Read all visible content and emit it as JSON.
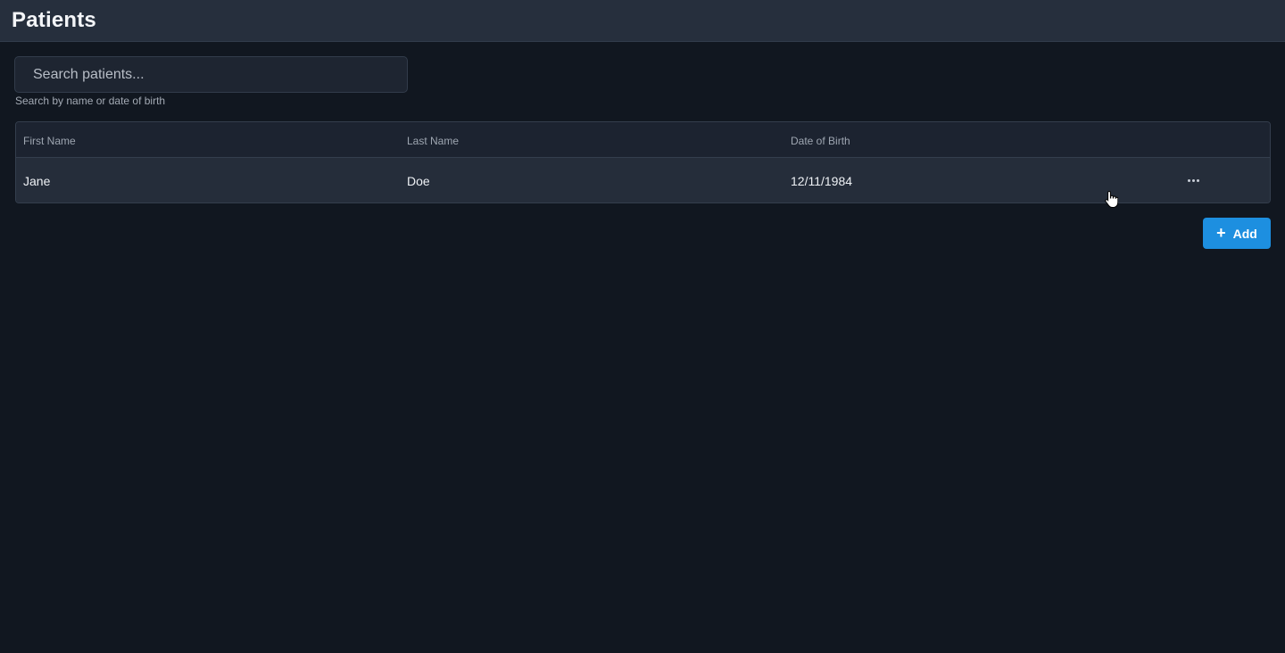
{
  "header": {
    "title": "Patients"
  },
  "search": {
    "placeholder": "Search patients...",
    "value": "",
    "hint": "Search by name or date of birth"
  },
  "table": {
    "columns": [
      "First Name",
      "Last Name",
      "Date of Birth"
    ],
    "rows": [
      {
        "first_name": "Jane",
        "last_name": "Doe",
        "dob": "12/11/1984",
        "actions_icon": "more-horizontal-icon"
      }
    ]
  },
  "add_button": {
    "label": "Add",
    "icon": "plus-icon"
  },
  "colors": {
    "background": "#111720",
    "header": "#262f3d",
    "accent": "#1d8fe0"
  }
}
